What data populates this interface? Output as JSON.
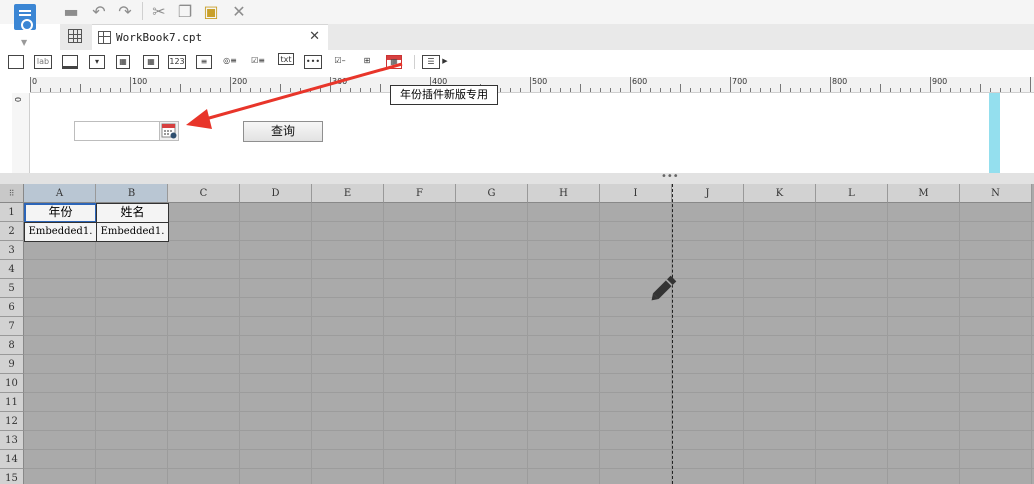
{
  "tab": {
    "title": "WorkBook7.cpt"
  },
  "toolbar": {
    "icons": [
      "save-icon",
      "undo-icon",
      "redo-icon",
      "cut-icon",
      "copy-icon",
      "paste-icon",
      "delete-icon"
    ]
  },
  "widgets": {
    "label_text": "lab",
    "number_text": "123",
    "txt_text": "txt"
  },
  "ruler": {
    "marks": [
      "0",
      "100",
      "200",
      "300",
      "400",
      "500",
      "600",
      "700",
      "800",
      "900"
    ]
  },
  "vruler": {
    "mark": "0"
  },
  "tooltip": {
    "text": "年份插件新版专用"
  },
  "form": {
    "query_button": "查询",
    "date_value": ""
  },
  "grid": {
    "columns": [
      "A",
      "B",
      "C",
      "D",
      "E",
      "F",
      "G",
      "H",
      "I",
      "J",
      "K",
      "L",
      "M",
      "N"
    ],
    "rows": [
      "1",
      "2",
      "3",
      "4",
      "5",
      "6",
      "7",
      "8",
      "9",
      "10",
      "11",
      "12",
      "13",
      "14",
      "15"
    ],
    "cells": {
      "A1": "年份",
      "B1": "姓名",
      "A2": "Embedded1.",
      "B2": "Embedded1."
    }
  }
}
